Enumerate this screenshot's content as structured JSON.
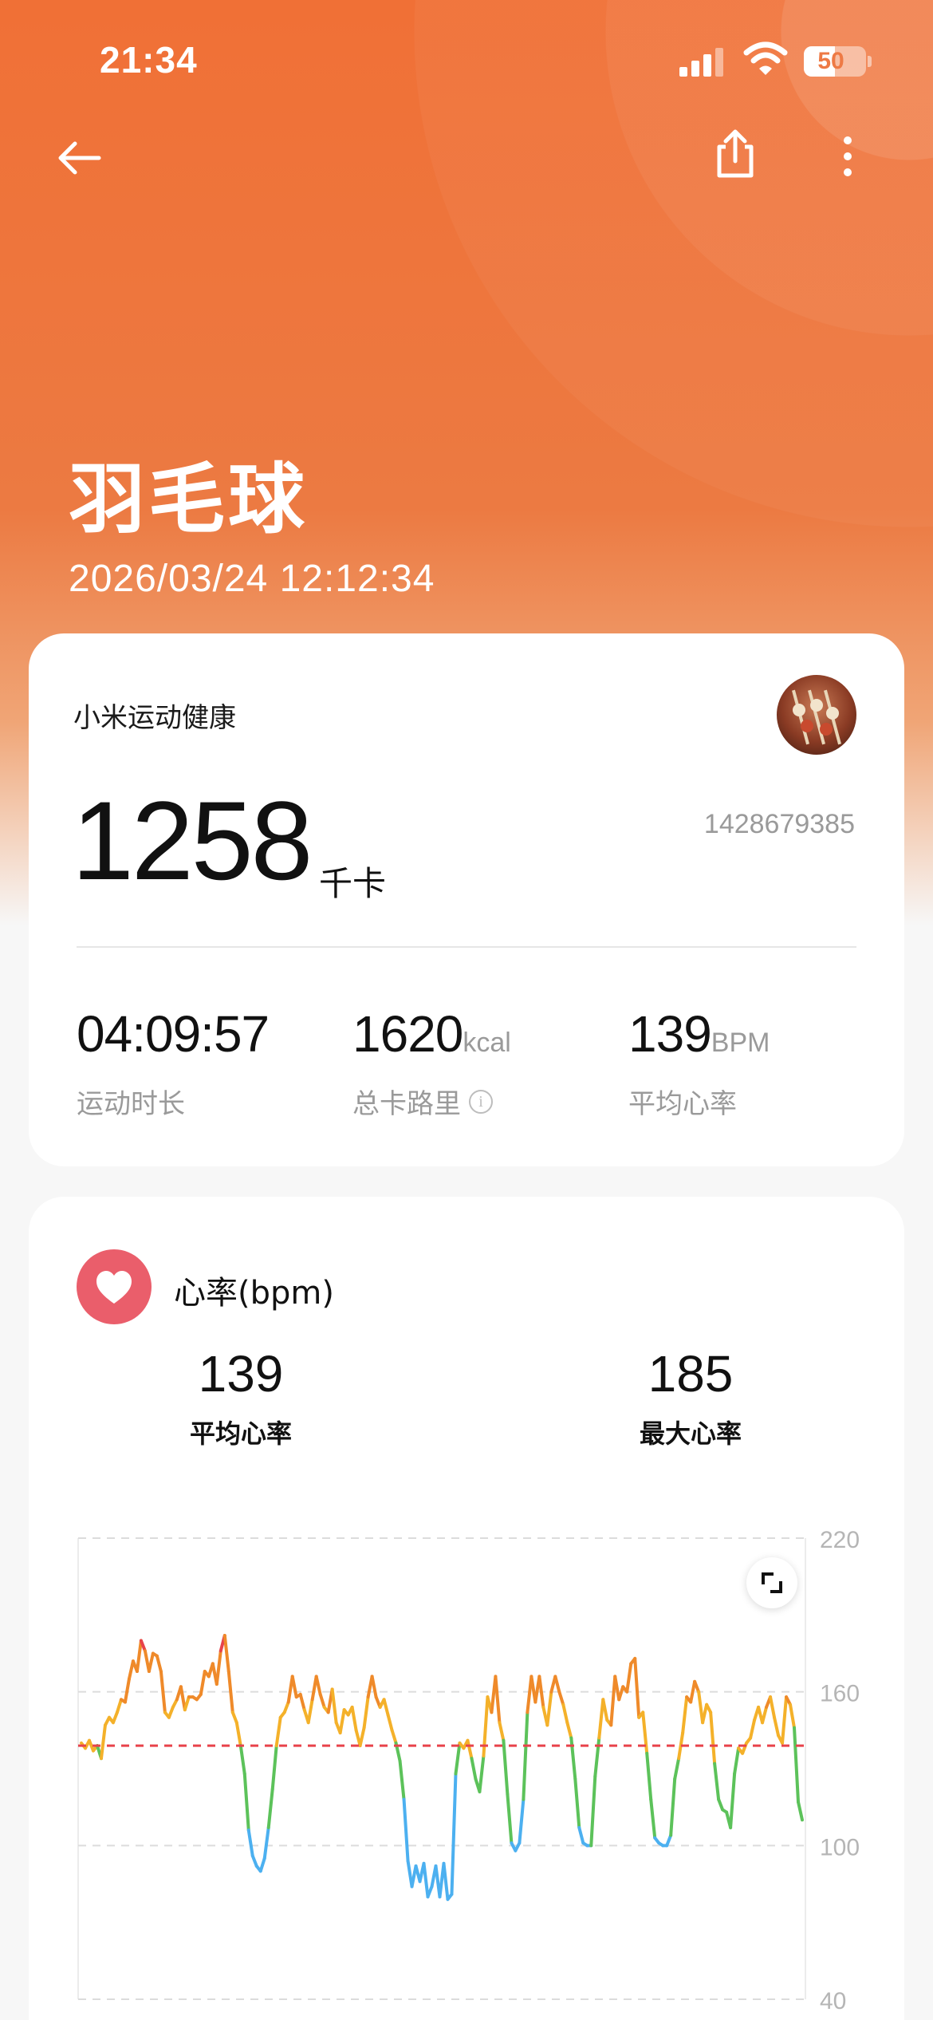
{
  "status_bar": {
    "time": "21:34",
    "battery": "50",
    "battery_level": 0.5
  },
  "header": {
    "title": "羽毛球",
    "datetime": "2026/03/24 12:12:34"
  },
  "summary": {
    "app_name": "小米运动健康",
    "calories_value": "1258",
    "calories_unit": "千卡",
    "user_id": "1428679385",
    "stats": [
      {
        "value": "04:09:57",
        "unit": "",
        "label": "运动时长"
      },
      {
        "value": "1620",
        "unit": "kcal",
        "label": "总卡路里"
      },
      {
        "value": "139",
        "unit": "BPM",
        "label": "平均心率"
      }
    ]
  },
  "heart_rate": {
    "title": "心率(bpm)",
    "avg_value": "139",
    "avg_label": "平均心率",
    "max_value": "185",
    "max_label": "最大心率"
  },
  "colors": {
    "hero": "#f07036",
    "heart_badge": "#ea5e6b",
    "avg_line": "#e8434b",
    "zone_low": "#4cb0f0",
    "zone_mid": "#5cc25a",
    "zone_high": "#f4b12a",
    "zone_higher": "#ef8a2a",
    "zone_max": "#e8434b"
  },
  "chart_data": {
    "type": "line",
    "title": "心率(bpm)",
    "xlabel": "",
    "ylabel": "",
    "ylim": [
      40,
      220
    ],
    "yticks": [
      220,
      160,
      100,
      40
    ],
    "grid": true,
    "reference_line": {
      "label": "平均心率",
      "y": 139
    },
    "series": [
      {
        "values": [
          140,
          138,
          141,
          137,
          139,
          134,
          147,
          150,
          148,
          152,
          157,
          156,
          165,
          172,
          168,
          180,
          176,
          168,
          175,
          174,
          168,
          152,
          150,
          154,
          157,
          162,
          153,
          158,
          158,
          157,
          159,
          168,
          166,
          171,
          163,
          176,
          182,
          168,
          152,
          148,
          139,
          128,
          106,
          96,
          92,
          90,
          95,
          107,
          122,
          139,
          150,
          152,
          156,
          166,
          158,
          159,
          153,
          148,
          157,
          166,
          159,
          154,
          152,
          161,
          148,
          144,
          153,
          151,
          154,
          145,
          139,
          146,
          158,
          166,
          158,
          154,
          157,
          151,
          145,
          140,
          133,
          118,
          94,
          84,
          92,
          86,
          93,
          80,
          84,
          92,
          80,
          93,
          79,
          81,
          128,
          140,
          138,
          141,
          134,
          126,
          121,
          135,
          158,
          152,
          166,
          148,
          141,
          120,
          101,
          98,
          101,
          118,
          152,
          166,
          156,
          166,
          154,
          147,
          160,
          166,
          160,
          155,
          148,
          142,
          126,
          107,
          101,
          100,
          100,
          127,
          142,
          157,
          149,
          147,
          166,
          157,
          162,
          160,
          171,
          173,
          150,
          152,
          136,
          118,
          103,
          101,
          100,
          100,
          104,
          126,
          134,
          144,
          158,
          156,
          164,
          160,
          148,
          155,
          152,
          132,
          118,
          114,
          113,
          107,
          128,
          138,
          136,
          140,
          142,
          149,
          154,
          148,
          154,
          158,
          150,
          143,
          140,
          158,
          155,
          146,
          117,
          110
        ]
      }
    ]
  }
}
